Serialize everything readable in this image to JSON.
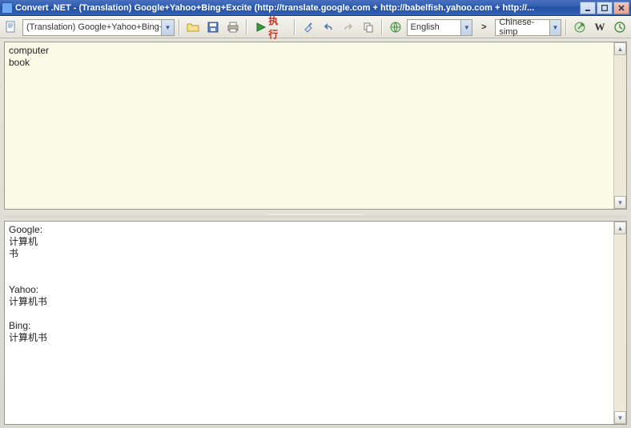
{
  "window": {
    "title": "Convert .NET - (Translation) Google+Yahoo+Bing+Excite (http://translate.google.com + http://babelfish.yahoo.com + http://..."
  },
  "toolbar": {
    "mode": "(Translation) Google+Yahoo+Bing+E",
    "execute_label": "执行",
    "lang_from": "English",
    "lang_to": "Chinese-simp",
    "swap_label": ">"
  },
  "input": {
    "text": "computer\nbook"
  },
  "output": {
    "text": "Google:\n计算机\n书\n\n\nYahoo:\n计算机书\n\nBing:\n计算机书"
  }
}
